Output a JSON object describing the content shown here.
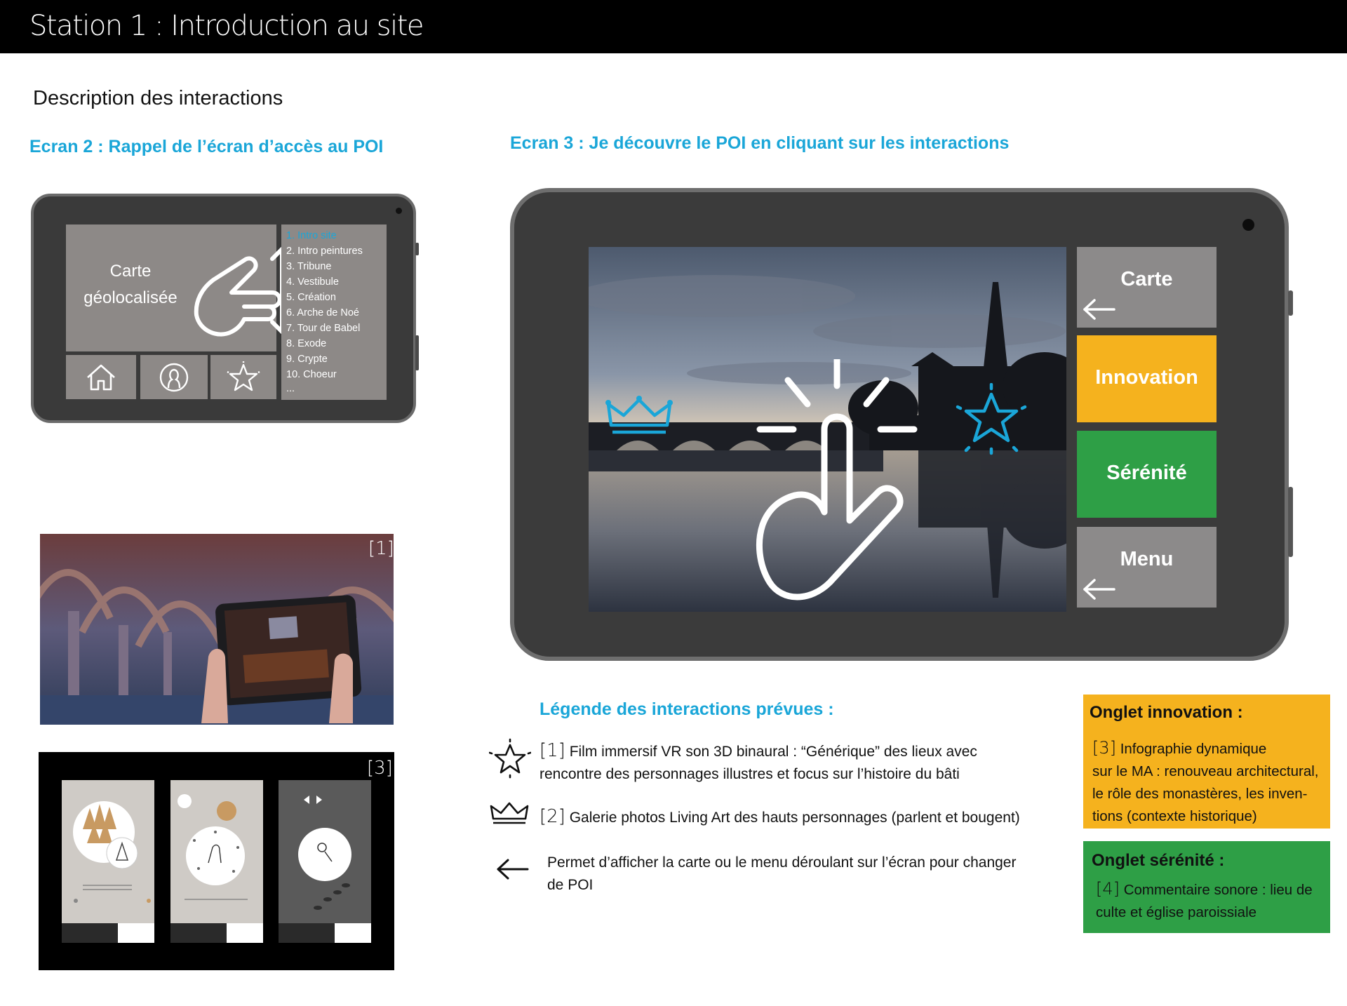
{
  "header": {
    "title": "Station 1 : Introduction au site"
  },
  "description_heading": "Description des interactions",
  "ecran2": {
    "title": "Ecran 2 : Rappel de l’écran d’accès au POI",
    "map_label_line1": "Carte",
    "map_label_line2": "géolocalisée",
    "list_items": [
      "1. Intro site",
      "2. Intro peintures",
      "3. Tribune",
      "4. Vestibule",
      "5. Création",
      "6. Arche de Noé",
      "7. Tour de Babel",
      "8. Exode",
      "9. Crypte",
      "10. Choeur",
      "..."
    ],
    "bottom_icons": [
      "home-icon",
      "user-icon",
      "star-icon"
    ]
  },
  "ecran3": {
    "title": "Ecran 3 : Je découvre le POI en cliquant sur les interactions",
    "buttons": {
      "carte": "Carte",
      "innovation": "Innovation",
      "serenite": "Sérénité",
      "menu": "Menu"
    }
  },
  "photo_tags": {
    "photo1": "[1]",
    "photo3": "[3]"
  },
  "legend": {
    "title": "Légende des interactions prévues :",
    "item1_ref": "[1]",
    "item1_line1": "Film immersif VR son 3D binaural : “Générique” des lieux avec",
    "item1_line2": "rencontre des personnages illustres et focus sur l’histoire du bâti",
    "item2_ref": "[2]",
    "item2_text": "Galerie photos Living Art des hauts personnages (parlent et bougent)",
    "item3_line1": "Permet d’afficher la carte ou le menu déroulant sur l’écran pour changer",
    "item3_line2": "de POI"
  },
  "onglet_innovation": {
    "title": "Onglet innovation :",
    "ref": "[3]",
    "line1": "Infographie dynamique",
    "line2": "sur le MA : renouveau architectural,",
    "line3": "le rôle des monastères, les inven-",
    "line4": "tions (contexte historique)"
  },
  "onglet_serenite": {
    "title": "Onglet sérénité :",
    "ref": "[4]",
    "line1": "Commentaire sonore : lieu de",
    "line2": "culte et église paroissiale"
  },
  "colors": {
    "cyan": "#1aa6d8",
    "innovation": "#f5b21e",
    "serenite": "#2e9f46",
    "grey_button": "#8c8a8a"
  }
}
